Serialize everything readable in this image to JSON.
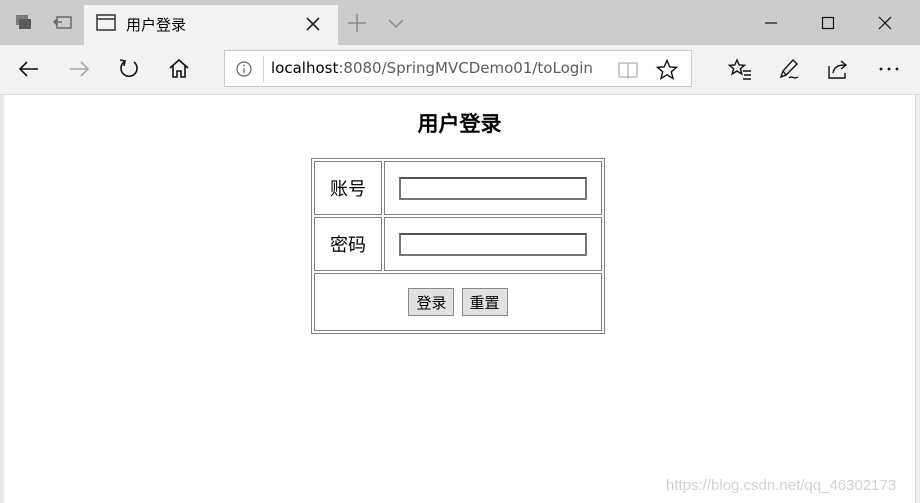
{
  "browser": {
    "tab": {
      "title": "用户登录"
    },
    "address": {
      "host": "localhost",
      "path": ":8080/SpringMVCDemo01/toLogin"
    },
    "icons": {
      "tab_actions": "tab-actions-icon",
      "tabs_aside": "set-tabs-aside-icon",
      "page": "page-icon",
      "close_tab": "close-tab-icon",
      "new_tab": "plus-icon",
      "tab_menu": "chevron-down-icon",
      "minimize": "minimize-icon",
      "maximize": "maximize-icon",
      "close_window": "close-window-icon",
      "back": "back-arrow-icon",
      "forward": "forward-arrow-icon",
      "refresh": "refresh-icon",
      "home": "home-icon",
      "info": "info-icon",
      "reading_view": "book-icon",
      "favorite": "star-icon",
      "favorites": "favorites-list-icon",
      "notes": "pen-icon",
      "share": "share-icon",
      "more": "more-icon"
    }
  },
  "page": {
    "title": "用户登录",
    "form": {
      "account_label": "账号",
      "account_value": "",
      "password_label": "密码",
      "password_value": "",
      "login_button": "登录",
      "reset_button": "重置"
    },
    "watermark": "https://blog.csdn.net/qq_46302173"
  },
  "colors": {
    "tab_strip": "#cccccc",
    "toolbar": "#f2f2f2",
    "content": "#ffffff",
    "border": "#808080"
  }
}
